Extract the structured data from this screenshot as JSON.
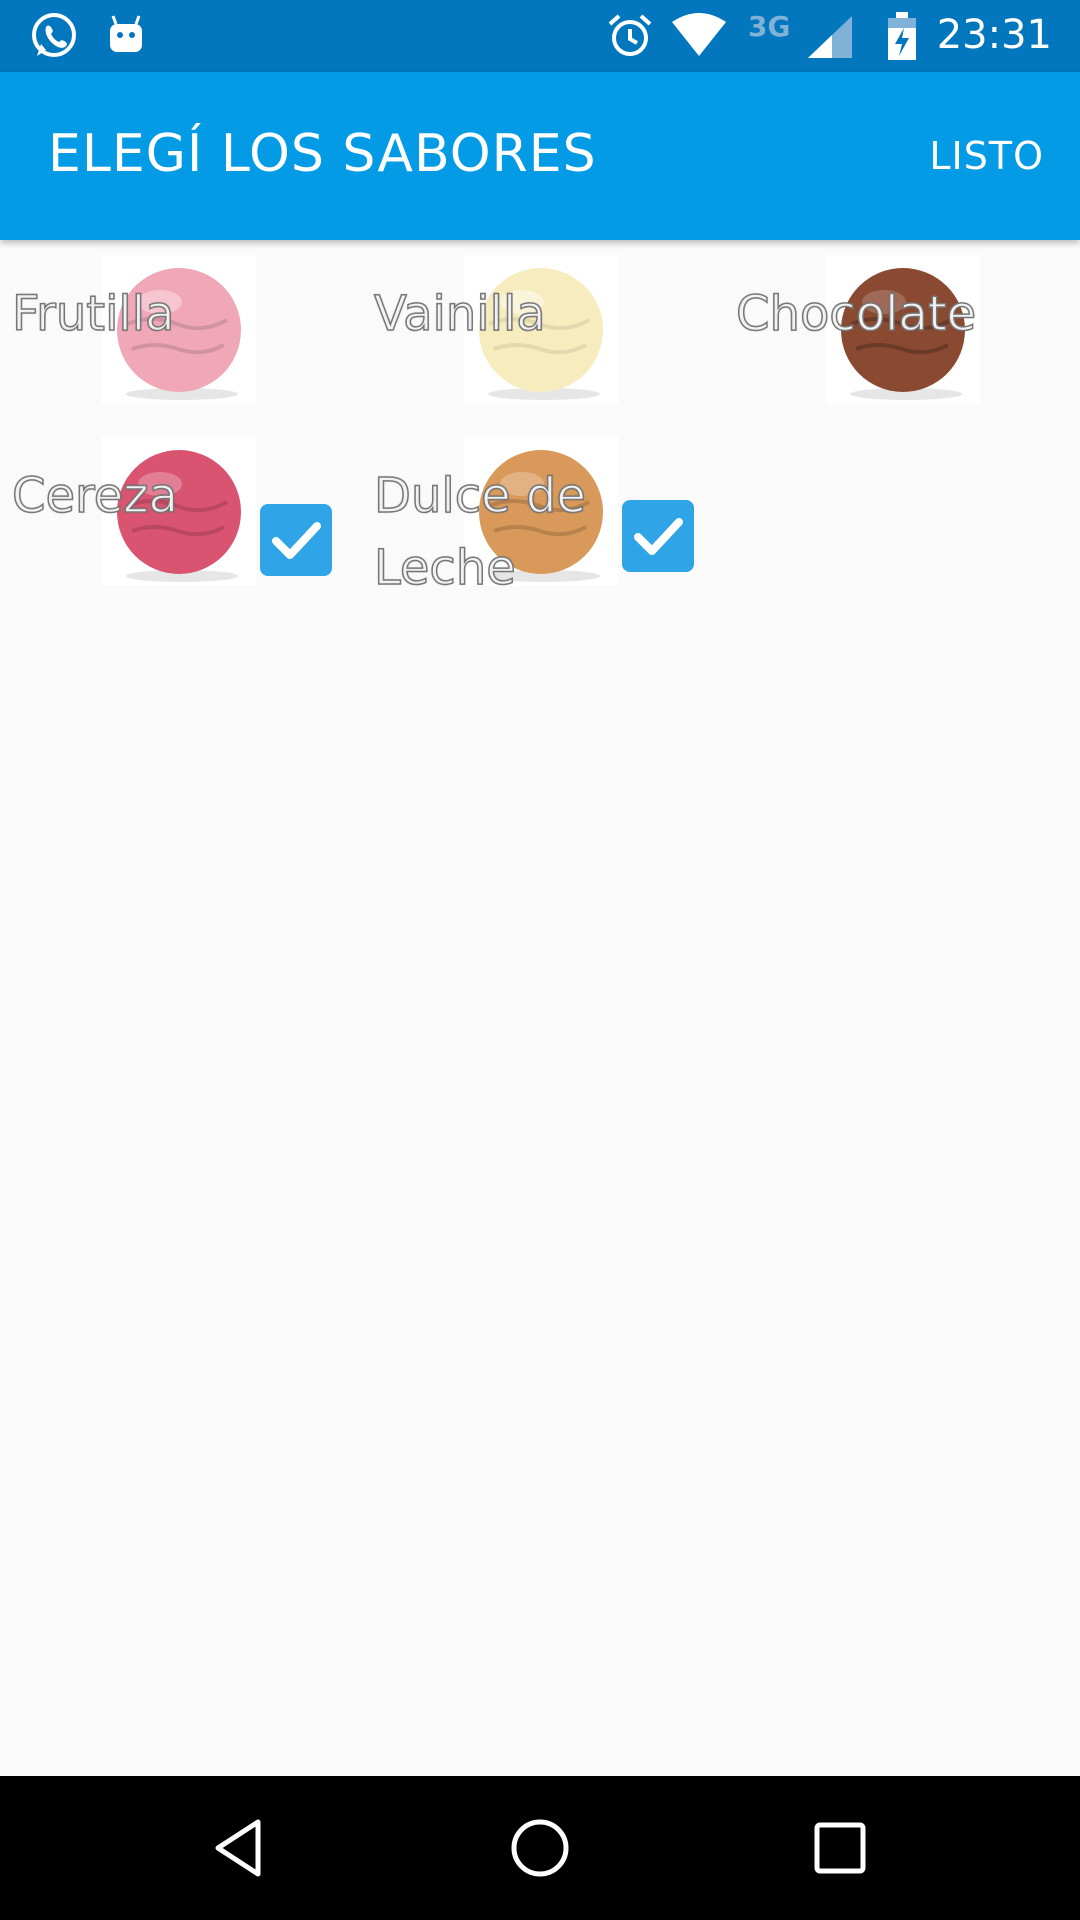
{
  "status_bar": {
    "time": "23:31",
    "network": "3G",
    "icons": [
      "whatsapp-icon",
      "android-icon",
      "alarm-icon",
      "wifi-icon",
      "signal-icon",
      "battery-charging-icon"
    ]
  },
  "app_bar": {
    "title": "ELEGÍ LOS SABORES",
    "action_label": "LISTO"
  },
  "flavors": [
    {
      "name": "Frutilla",
      "checked": false,
      "color": "#f0a8b8"
    },
    {
      "name": "Vainilla",
      "checked": false,
      "color": "#f6ecbe"
    },
    {
      "name": "Chocolate",
      "checked": false,
      "color": "#8a4a32"
    },
    {
      "name": "Cereza",
      "checked": true,
      "color": "#d95470"
    },
    {
      "name": "Dulce de Leche",
      "checked": true,
      "color": "#d9995a"
    }
  ],
  "colors": {
    "status_bar": "#0277bd",
    "app_bar": "#039be5",
    "checkbox": "#2fa4e7",
    "background": "#fafafa"
  },
  "nav_bar": {
    "icons": [
      "back-icon",
      "home-icon",
      "recents-icon"
    ]
  }
}
